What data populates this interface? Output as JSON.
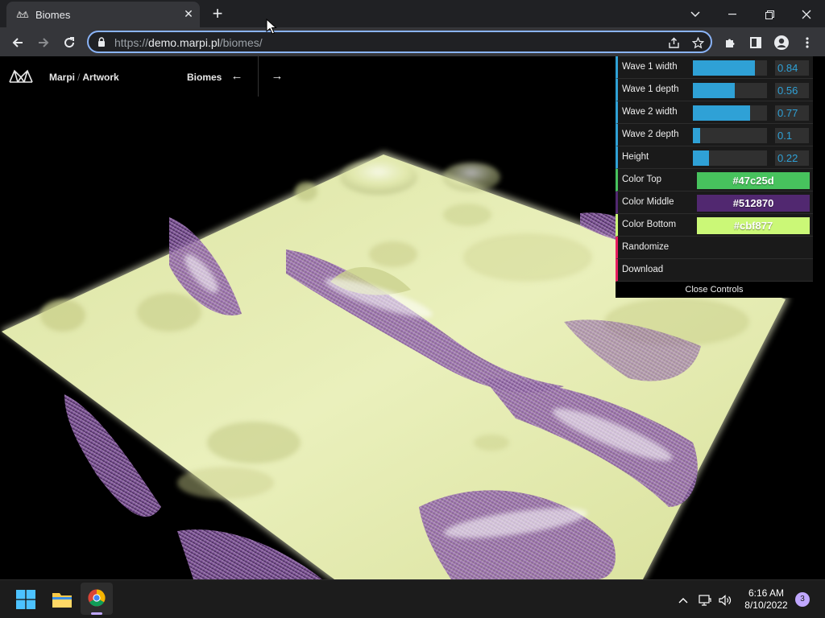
{
  "browser": {
    "tab_title": "Biomes",
    "tab_close": "✕",
    "new_tab": "+",
    "url_scheme": "https://",
    "url_host": "demo.marpi.pl",
    "url_path": "/biomes/"
  },
  "site": {
    "brand_name": "Marpi",
    "brand_separator": "/",
    "brand_section": "Artwork",
    "page_name": "Biomes",
    "prev_arrow": "←",
    "next_arrow": "→"
  },
  "controls": {
    "sliders": [
      {
        "label": "Wave 1 width",
        "value": "0.84",
        "fill": 0.84
      },
      {
        "label": "Wave 1 depth",
        "value": "0.56",
        "fill": 0.56
      },
      {
        "label": "Wave 2 width",
        "value": "0.77",
        "fill": 0.77
      },
      {
        "label": "Wave 2 depth",
        "value": "0.1",
        "fill": 0.1
      },
      {
        "label": "Height",
        "value": "0.22",
        "fill": 0.22
      }
    ],
    "colors": [
      {
        "label": "Color Top",
        "value": "#47c25d",
        "text_color": "#ffffff",
        "border": "#47c25d"
      },
      {
        "label": "Color Middle",
        "value": "#512870",
        "text_color": "#ffffff",
        "border": "#512870"
      },
      {
        "label": "Color Bottom",
        "value": "#cbf877",
        "text_color": "#ffffff",
        "border": "#cbf877"
      }
    ],
    "actions": [
      {
        "label": "Randomize"
      },
      {
        "label": "Download"
      }
    ],
    "close_label": "Close Controls"
  },
  "taskbar": {
    "time": "6:16 AM",
    "date": "8/10/2022",
    "notification_count": "3"
  },
  "theme": {
    "accent": "#2fa1d6",
    "function_accent": "#e61d5f",
    "terrain_base": "#e6edb3",
    "terrain_ridge": "#9a6fb0"
  }
}
